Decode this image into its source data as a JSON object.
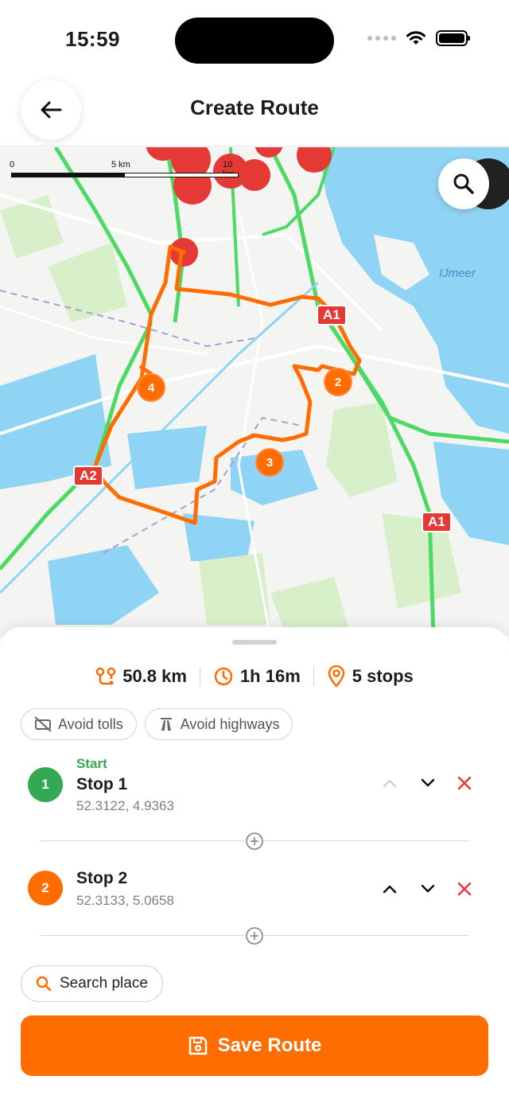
{
  "status_bar": {
    "time": "15:59"
  },
  "header": {
    "title": "Create Route"
  },
  "map": {
    "scale": {
      "label_0": "0",
      "label_5": "5 km",
      "label_10": "10 km"
    },
    "lake_label": "IJmeer",
    "road_badges": [
      "A1",
      "A1",
      "A2"
    ],
    "stop_markers": [
      "2",
      "3",
      "4"
    ]
  },
  "summary": {
    "distance": "50.8 km",
    "duration": "1h 16m",
    "stops": "5 stops"
  },
  "options": {
    "avoid_tolls": "Avoid tolls",
    "avoid_highways": "Avoid highways"
  },
  "stops": [
    {
      "number": "1",
      "tag": "Start",
      "name": "Stop 1",
      "coords": "52.3122, 4.9363"
    },
    {
      "number": "2",
      "name": "Stop 2",
      "coords": "52.3133, 5.0658"
    }
  ],
  "actions": {
    "search_place": "Search place",
    "save_route": "Save Route"
  },
  "colors": {
    "accent": "#ff6d00",
    "start": "#34a853",
    "danger": "#e53935"
  }
}
